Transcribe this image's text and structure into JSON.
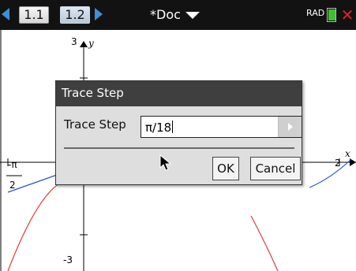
{
  "topbar": {
    "tabs": [
      "1.1",
      "1.2"
    ],
    "doc_title": "*Doc",
    "angle_mode": "RAD",
    "icons": {
      "prev": "left-arrow-icon",
      "next": "right-arrow-icon",
      "doc_menu": "chevron-down-icon",
      "battery": "battery-icon",
      "close": "close-icon"
    }
  },
  "graph": {
    "y_axis_label": "y",
    "x_axis_label": "x",
    "y_max_label": "3",
    "y_min_label": "-3",
    "x_left_label_num": "-π",
    "x_left_label_den": "2",
    "x_right_label": "2"
  },
  "dialog": {
    "title": "Trace Step",
    "field_label": "Trace Step",
    "field_value": "π/18",
    "ok_label": "OK",
    "cancel_label": "Cancel"
  },
  "colors": {
    "blue_curve": "#2a50d8",
    "red_curve": "#e23a3a",
    "topbar_bg": "#121212",
    "dialog_title_bg": "#3f3f3f"
  }
}
